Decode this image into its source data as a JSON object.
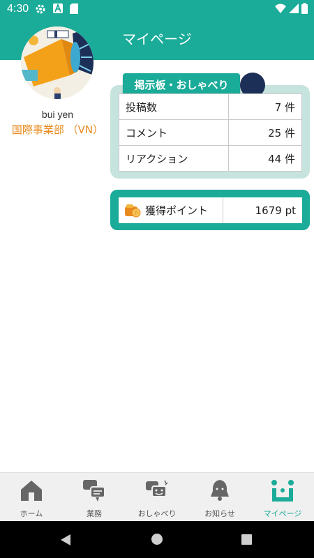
{
  "status_bar": {
    "time": "4:30"
  },
  "header": {
    "title": "マイページ"
  },
  "profile": {
    "name": "bui yen",
    "department": "国際事業部 （VN）"
  },
  "board": {
    "tab_label": "掲示板・おしゃべり",
    "rows": [
      {
        "label": "投稿数",
        "value": "7 件"
      },
      {
        "label": "コメント",
        "value": "25 件"
      },
      {
        "label": "リアクション",
        "value": "44 件"
      }
    ]
  },
  "points": {
    "label": "獲得ポイント",
    "value": "1679 pt"
  },
  "nav": {
    "items": [
      {
        "label": "ホーム",
        "icon": "home-icon"
      },
      {
        "label": "業務",
        "icon": "chat-bubbles-icon"
      },
      {
        "label": "おしゃべり",
        "icon": "chat-smile-icon"
      },
      {
        "label": "お知らせ",
        "icon": "bell-icon"
      },
      {
        "label": "マイページ",
        "icon": "mypage-icon"
      }
    ],
    "active": "マイページ"
  },
  "colors": {
    "brand": "#1aab99",
    "dept": "#e98a1e",
    "card_bg": "#c6e3dd"
  }
}
